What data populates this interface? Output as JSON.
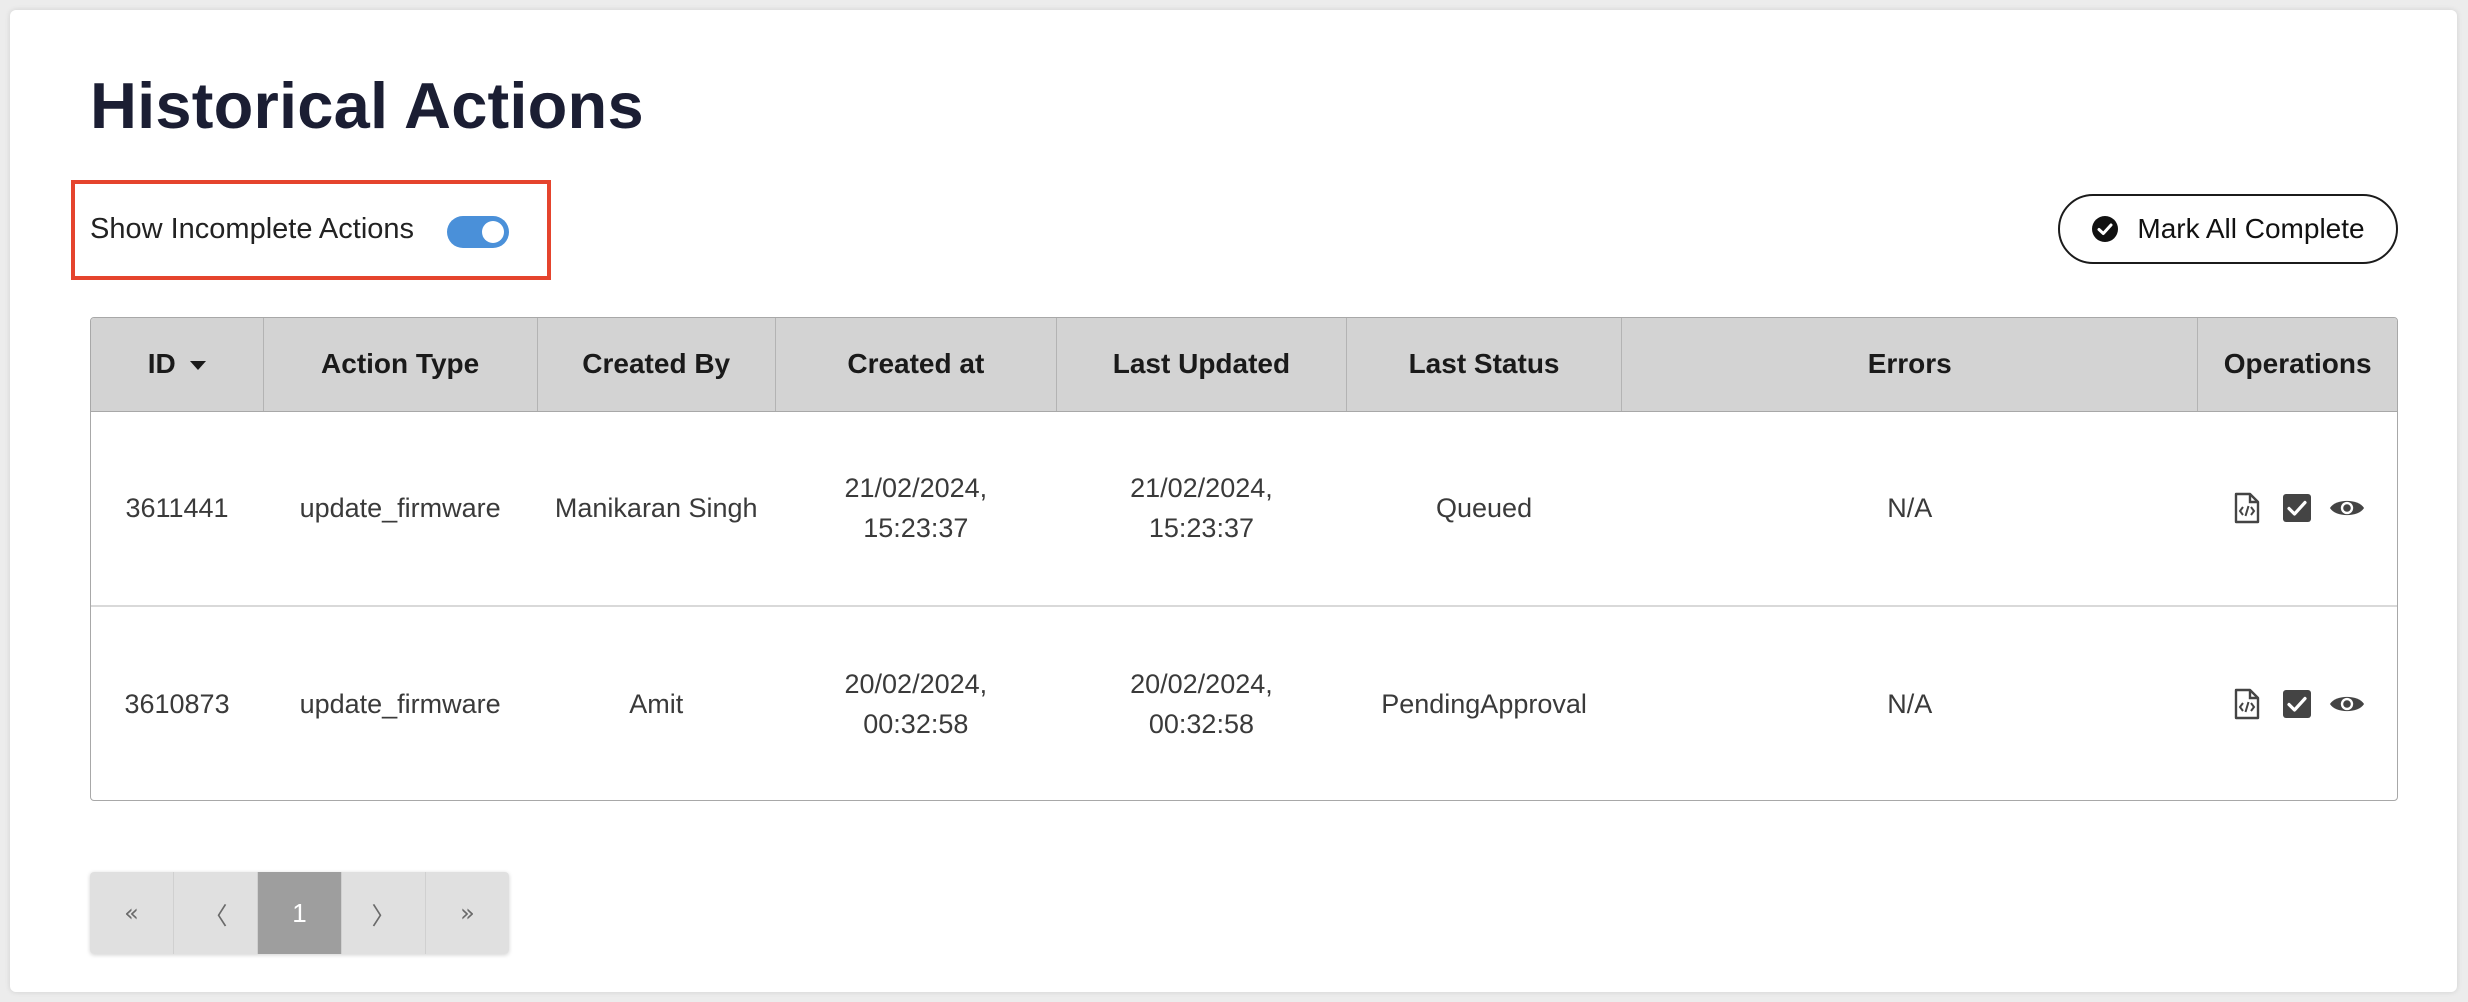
{
  "page": {
    "title": "Historical Actions"
  },
  "toolbar": {
    "toggle_label": "Show Incomplete Actions",
    "toggle_on": true,
    "mark_all_label": "Mark All Complete"
  },
  "table": {
    "columns": [
      "ID",
      "Action Type",
      "Created By",
      "Created at",
      "Last Updated",
      "Last Status",
      "Errors",
      "Operations"
    ],
    "rows": [
      {
        "id": "3611441",
        "action_type": "update_firmware",
        "created_by": "Manikaran Singh",
        "created_at_date": "21/02/2024,",
        "created_at_time": "15:23:37",
        "updated_date": "21/02/2024,",
        "updated_time": "15:23:37",
        "status": "Queued",
        "errors": "N/A"
      },
      {
        "id": "3610873",
        "action_type": "update_firmware",
        "created_by": "Amit",
        "created_at_date": "20/02/2024,",
        "created_at_time": "00:32:58",
        "updated_date": "20/02/2024,",
        "updated_time": "00:32:58",
        "status": "PendingApproval",
        "errors": "N/A"
      }
    ],
    "operation_icons": [
      "code-file-icon",
      "checkbox-icon",
      "eye-icon"
    ]
  },
  "pagination": {
    "first": "«",
    "prev": "〈",
    "current": "1",
    "next": "〉",
    "last": "»"
  },
  "colors": {
    "accent": "#4a90d9",
    "highlight_border": "#e5442d",
    "header_bg": "#d3d3d3"
  }
}
